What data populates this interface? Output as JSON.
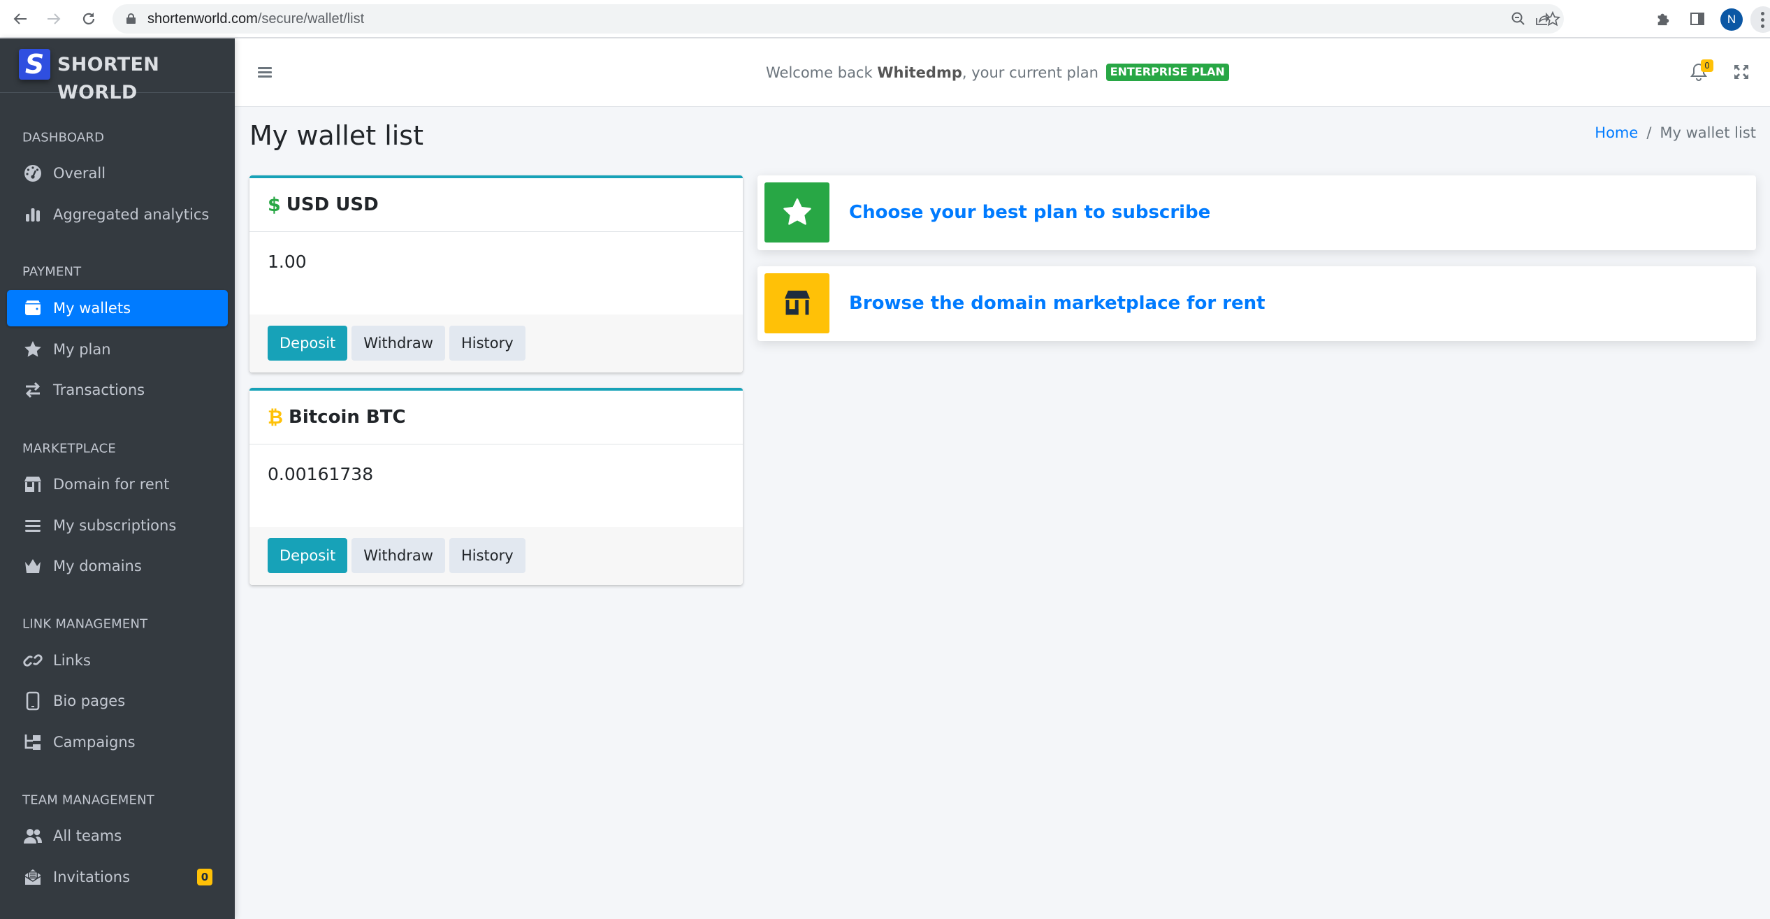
{
  "browser": {
    "url_host": "shortenworld.com",
    "url_path": "/secure/wallet/list",
    "profile_initial": "N"
  },
  "brand": {
    "logo_letter": "S",
    "name": "SHORTEN WORLD"
  },
  "sidebar": {
    "sections": [
      {
        "header": "DASHBOARD",
        "items": [
          {
            "label": "Overall",
            "icon": "tachometer-icon"
          },
          {
            "label": "Aggregated analytics",
            "icon": "bar-chart-icon"
          }
        ]
      },
      {
        "header": "PAYMENT",
        "items": [
          {
            "label": "My wallets",
            "icon": "wallet-icon",
            "active": true
          },
          {
            "label": "My plan",
            "icon": "star-icon"
          },
          {
            "label": "Transactions",
            "icon": "exchange-icon"
          }
        ]
      },
      {
        "header": "MARKETPLACE",
        "items": [
          {
            "label": "Domain for rent",
            "icon": "store-icon"
          },
          {
            "label": "My subscriptions",
            "icon": "list-icon"
          },
          {
            "label": "My domains",
            "icon": "crown-icon"
          }
        ]
      },
      {
        "header": "LINK MANAGEMENT",
        "items": [
          {
            "label": "Links",
            "icon": "link-icon"
          },
          {
            "label": "Bio pages",
            "icon": "mobile-icon"
          },
          {
            "label": "Campaigns",
            "icon": "sitemap-icon"
          }
        ]
      },
      {
        "header": "TEAM MANAGEMENT",
        "items": [
          {
            "label": "All teams",
            "icon": "users-icon"
          },
          {
            "label": "Invitations",
            "icon": "envelope-open-icon",
            "badge": "0"
          }
        ]
      }
    ]
  },
  "topbar": {
    "welcome_prefix": "Welcome back ",
    "username": "Whitedmp",
    "welcome_suffix": ", your current plan",
    "plan_badge": "ENTERPRISE PLAN",
    "notification_count": "0"
  },
  "page": {
    "title": "My wallet list",
    "breadcrumb": {
      "home": "Home",
      "separator": "/",
      "current": "My wallet list"
    }
  },
  "wallets": [
    {
      "icon": "$",
      "icon_name": "dollar-icon",
      "icon_color": "#28a745",
      "title": "USD USD",
      "balance": "1.00",
      "buttons": {
        "deposit": "Deposit",
        "withdraw": "Withdraw",
        "history": "History"
      }
    },
    {
      "icon": "₿",
      "icon_name": "bitcoin-icon",
      "icon_color": "#ffc107",
      "title": "Bitcoin BTC",
      "balance": "0.00161738",
      "buttons": {
        "deposit": "Deposit",
        "withdraw": "Withdraw",
        "history": "History"
      }
    }
  ],
  "info_boxes": [
    {
      "text": "Choose your best plan to subscribe",
      "icon": "star-icon",
      "color": "#28a745"
    },
    {
      "text": "Browse the domain marketplace for rent",
      "icon": "store-icon",
      "color": "#ffc107"
    }
  ],
  "colors": {
    "sidebar_bg": "#343a40",
    "active_item": "#007bff",
    "link": "#007bff",
    "deposit_button": "#17a2b8",
    "plan_badge": "#28a745",
    "badge_warning": "#ffc107"
  }
}
